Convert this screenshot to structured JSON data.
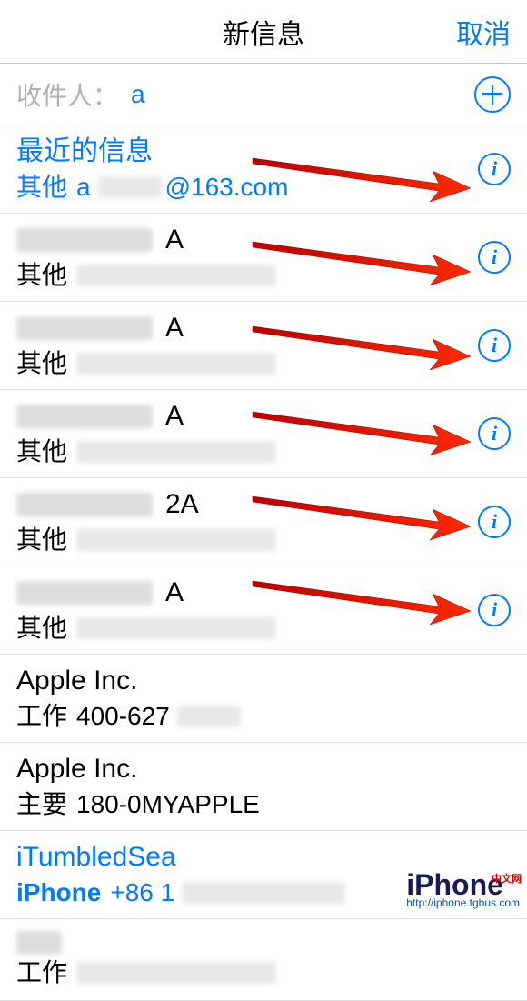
{
  "header": {
    "title": "新信息",
    "cancel_label": "取消"
  },
  "recipient": {
    "label": "收件人：",
    "value": "a"
  },
  "items": [
    {
      "line1": "最近的信息",
      "line2_type": "其他",
      "line2_value_prefix": "a",
      "line2_value_suffix": "@163.com",
      "blue": true,
      "hasInfo": true,
      "hasArrow": true,
      "blurMiddle": true
    },
    {
      "line1_suffix": "A",
      "line2_type": "其他",
      "blue": false,
      "hasInfo": true,
      "hasArrow": true,
      "blurName": true,
      "blurValue": true
    },
    {
      "line1_suffix": "A",
      "line2_type": "其他",
      "blue": false,
      "hasInfo": true,
      "hasArrow": true,
      "blurName": true,
      "blurValue": true
    },
    {
      "line1_suffix": "A",
      "line2_type": "其他",
      "blue": false,
      "hasInfo": true,
      "hasArrow": true,
      "blurName": true,
      "blurValue": true
    },
    {
      "line1_suffix": "2A",
      "line2_type": "其他",
      "blue": false,
      "hasInfo": true,
      "hasArrow": true,
      "blurName": true,
      "blurValue": true
    },
    {
      "line1_suffix": "A",
      "line2_type": "其他",
      "blue": false,
      "hasInfo": true,
      "hasArrow": true,
      "blurName": true,
      "blurValue": true
    },
    {
      "line1": "Apple Inc.",
      "line2_type": "工作",
      "line2_value_prefix": "400-627",
      "blue": false,
      "hasInfo": false,
      "hasArrow": false,
      "blurSuffix": true
    },
    {
      "line1": "Apple Inc.",
      "line2_type": "主要",
      "line2_value_prefix": "180-0MYAPPLE",
      "blue": false,
      "hasInfo": false,
      "hasArrow": false
    },
    {
      "line1": "iTumbledSea",
      "line2_type": "iPhone",
      "line2_value_prefix": "+86 1",
      "blue": true,
      "line2_bold_type": true,
      "hasInfo": false,
      "hasArrow": false,
      "blurSuffix": true
    },
    {
      "line2_type": "工作",
      "blue": false,
      "hasInfo": false,
      "hasArrow": false,
      "blurName": true,
      "blurValue": true,
      "short": true
    }
  ],
  "watermark": {
    "main": "iPhone",
    "zh": "中文网",
    "sub": "http://iphone.tgbus.com"
  }
}
